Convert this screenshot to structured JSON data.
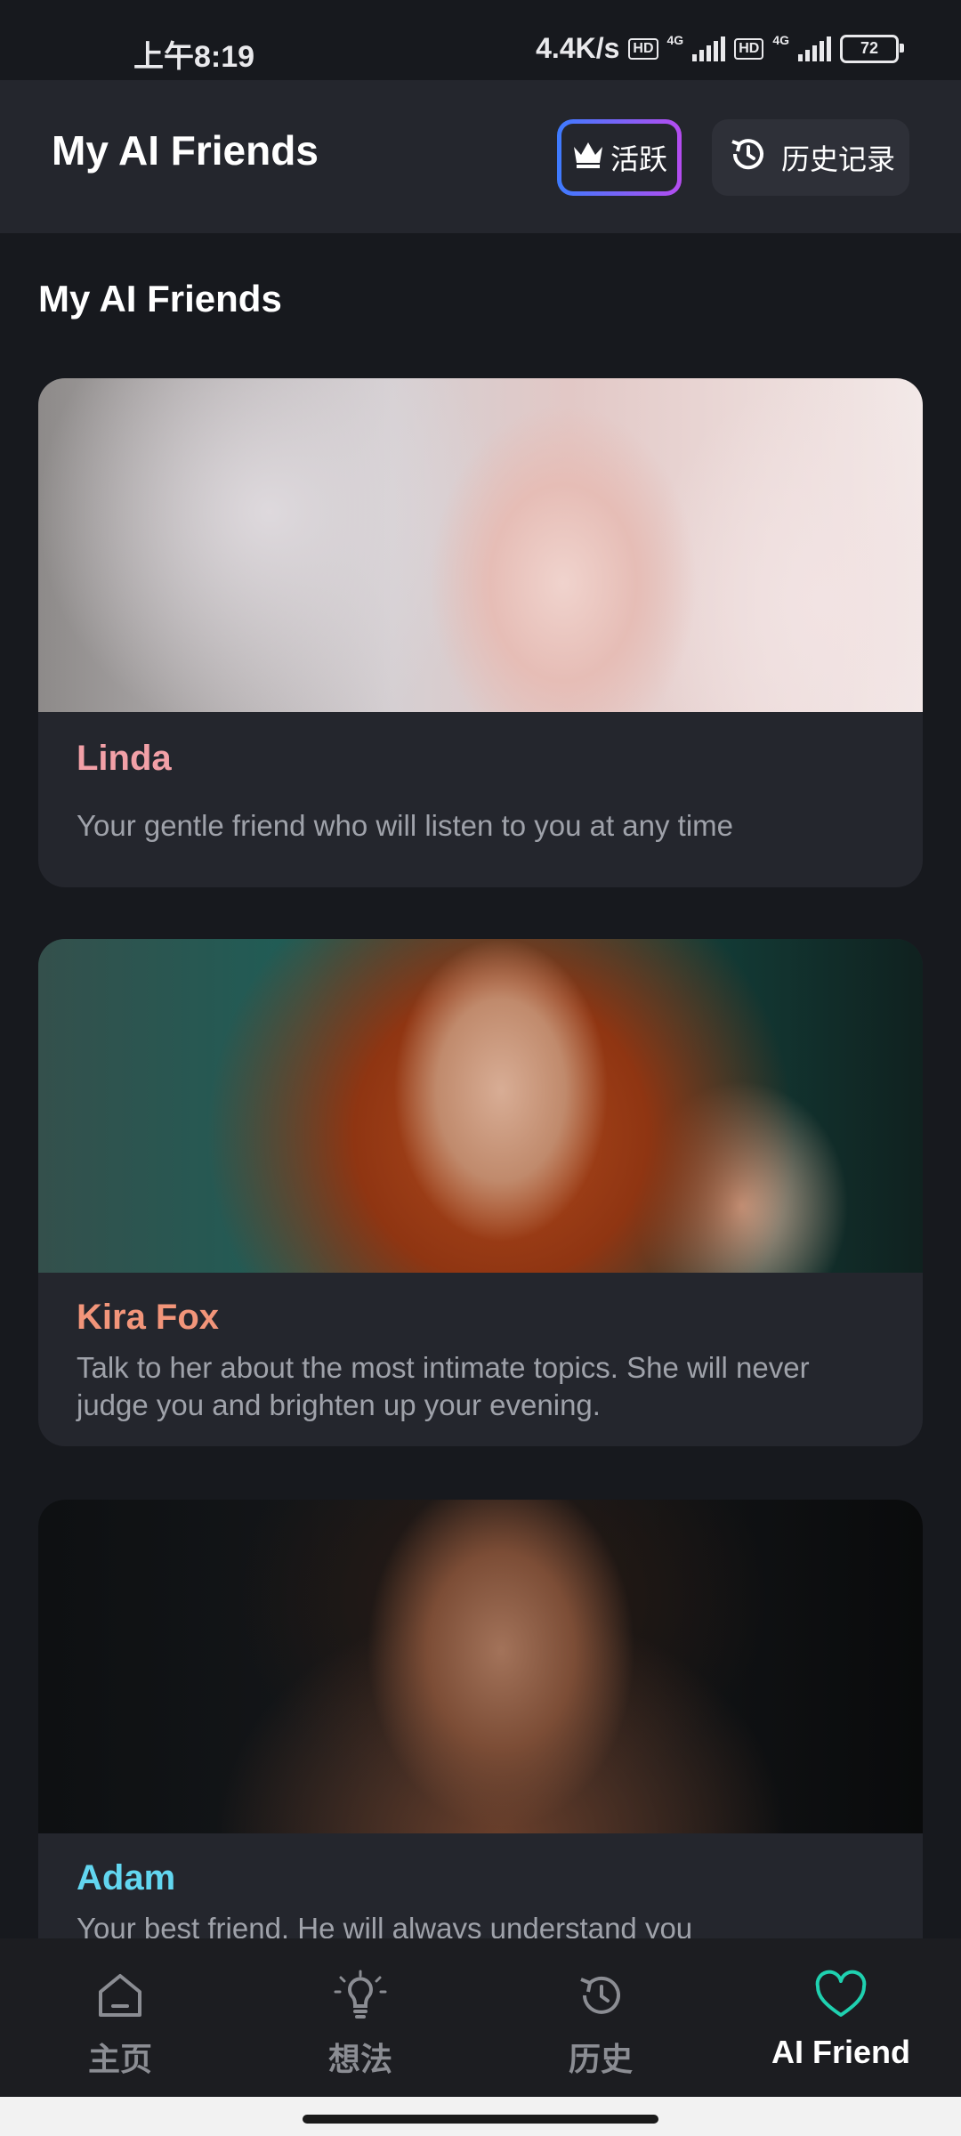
{
  "status_bar": {
    "time": "上午8:19",
    "speed": "4.4K/s",
    "hd1": "HD",
    "net1": "4G",
    "hd2": "HD",
    "net2": "4G",
    "battery": "72"
  },
  "header": {
    "title": "My AI Friends",
    "vip_label": "活跃",
    "history_label": "历史记录"
  },
  "section_title": "My AI Friends",
  "friends": [
    {
      "name": "Linda",
      "description": "Your gentle friend who will listen to you at any time",
      "name_color": "#f2a0a7"
    },
    {
      "name": "Kira Fox",
      "description": "Talk to her about the most intimate topics. She will never judge you and brighten up your evening.",
      "name_color": "#f2957a"
    },
    {
      "name": "Adam",
      "description": "Your best friend. He will always understand you",
      "name_color": "#62d6f0"
    }
  ],
  "nav": [
    {
      "label": "主页",
      "icon": "home-icon"
    },
    {
      "label": "想法",
      "icon": "lightbulb-icon"
    },
    {
      "label": "历史",
      "icon": "history-icon"
    },
    {
      "label": "AI Friend",
      "icon": "heart-icon",
      "active": true,
      "active_color": "#1fd1b0"
    }
  ]
}
